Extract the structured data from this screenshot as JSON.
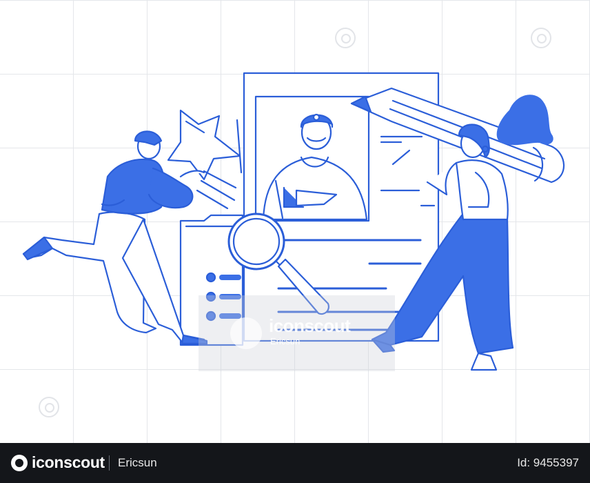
{
  "watermark": {
    "brand": "iconscout",
    "author": "Ericsun"
  },
  "footer": {
    "brand": "iconscout",
    "author": "Ericsun",
    "asset_id": "Id: 9455397"
  },
  "colors": {
    "accent": "#3b6fe6",
    "outline": "#2b5ed8",
    "footer_bg": "#14161a",
    "grid": "#e4e6ea"
  },
  "illustration": {
    "subject": "people-editing-resume",
    "icons": [
      "star-icon",
      "pencil-icon",
      "magnifier-icon",
      "resume-document",
      "folder-icon"
    ]
  }
}
